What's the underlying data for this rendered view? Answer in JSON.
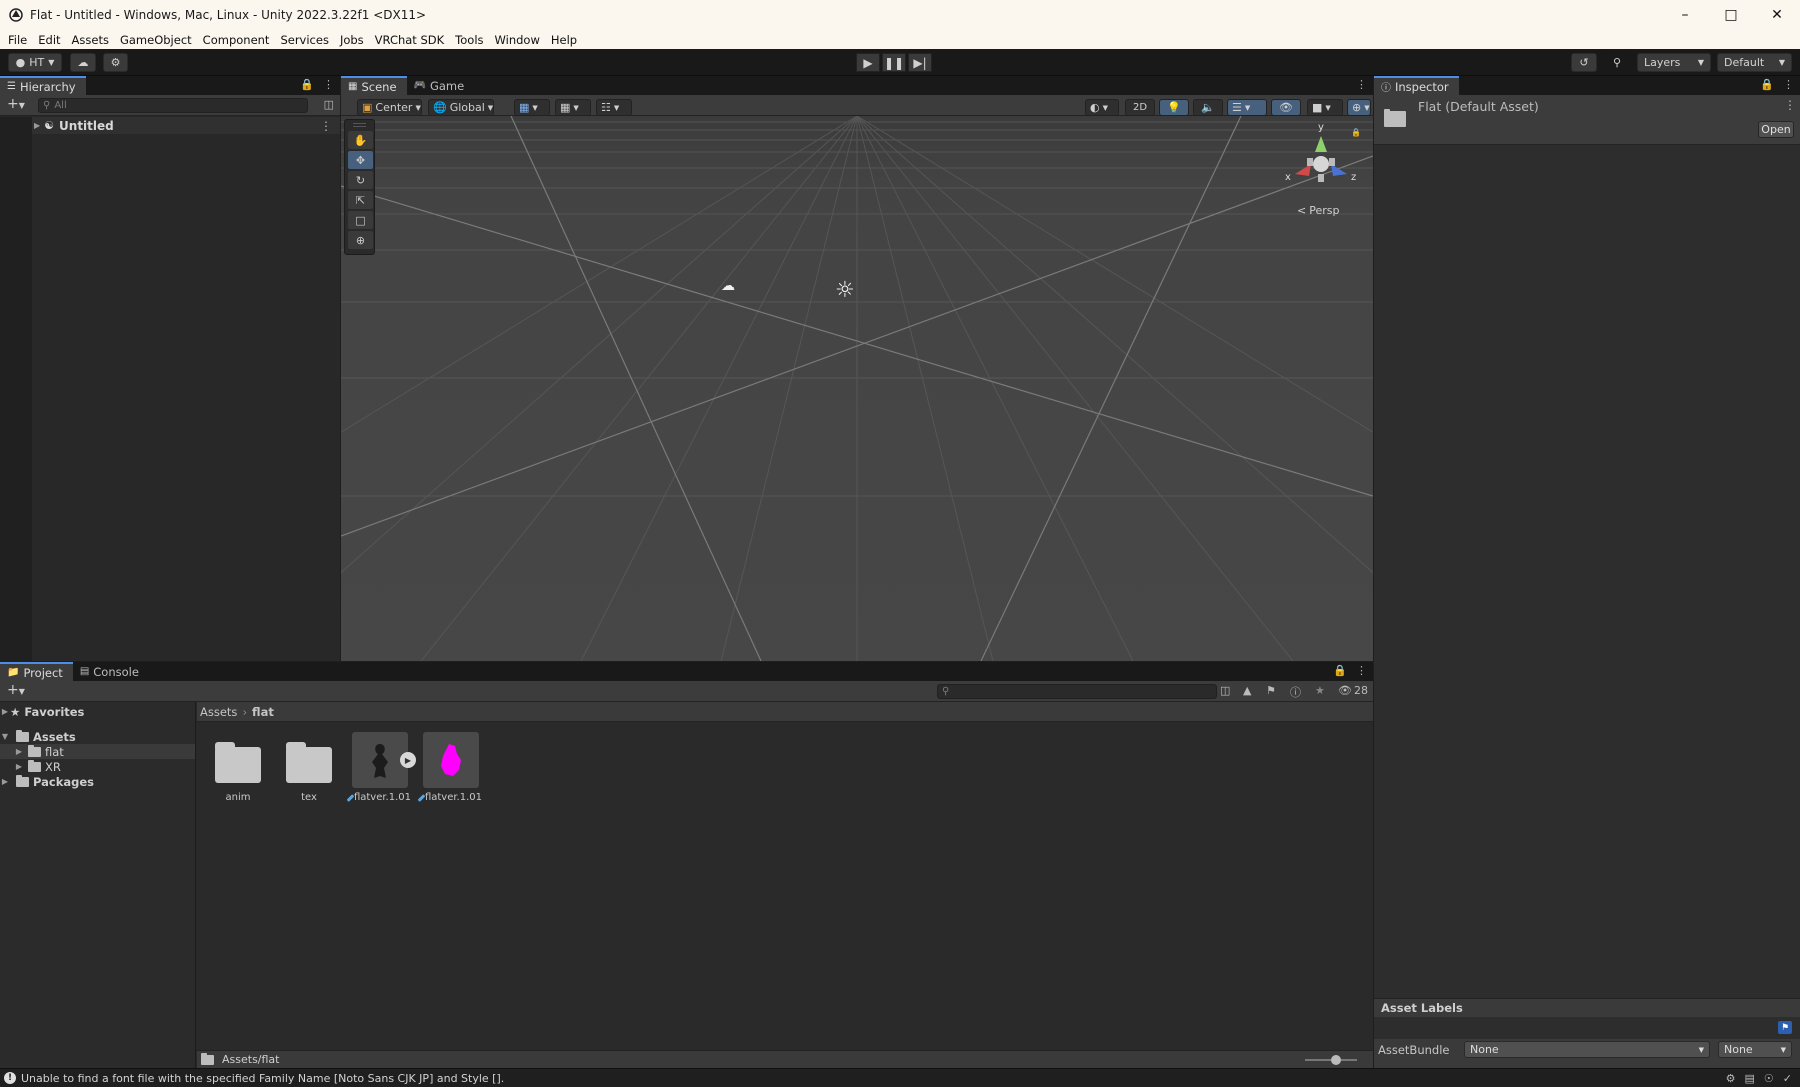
{
  "window": {
    "title": "Flat - Untitled - Windows, Mac, Linux - Unity 2022.3.22f1 <DX11>"
  },
  "menu": [
    "File",
    "Edit",
    "Assets",
    "GameObject",
    "Component",
    "Services",
    "Jobs",
    "VRChat SDK",
    "Tools",
    "Window",
    "Help"
  ],
  "toolbar": {
    "account_label": "HT",
    "layers_label": "Layers",
    "layout_label": "Default"
  },
  "hierarchy": {
    "tab_label": "Hierarchy",
    "search_placeholder": "All",
    "scene_name": "Untitled"
  },
  "scene": {
    "tabs": [
      "Scene",
      "Game"
    ],
    "pivot_mode": "Center",
    "pivot_rotation": "Global",
    "mode_2d": "2D",
    "projection_label": "Persp",
    "axes": {
      "x": "x",
      "y": "y",
      "z": "z"
    }
  },
  "inspector": {
    "tab_label": "Inspector",
    "asset_name": "Flat (Default Asset)",
    "open_button": "Open",
    "asset_labels_header": "Asset Labels",
    "asset_bundle_label": "AssetBundle",
    "asset_bundle_value": "None",
    "asset_bundle_variant": "None"
  },
  "project": {
    "tabs": [
      "Project",
      "Console"
    ],
    "hidden_count": "28",
    "tree": {
      "favorites": "Favorites",
      "assets": "Assets",
      "flat": "flat",
      "xr": "XR",
      "packages": "Packages"
    },
    "breadcrumb": {
      "root": "Assets",
      "current": "flat"
    },
    "items": [
      {
        "name": "anim",
        "type": "folder"
      },
      {
        "name": "tex",
        "type": "folder"
      },
      {
        "name": "flatver.1.01",
        "type": "model"
      },
      {
        "name": "flatver.1.01",
        "type": "prefab"
      }
    ],
    "path": "Assets/flat"
  },
  "status": {
    "message": "Unable to find a font file with the specified Family Name [Noto Sans CJK JP] and Style []."
  },
  "colors": {
    "accent": "#4d8ee9",
    "prefab_magenta": "#ff00ff",
    "panel_bg": "#282828"
  }
}
